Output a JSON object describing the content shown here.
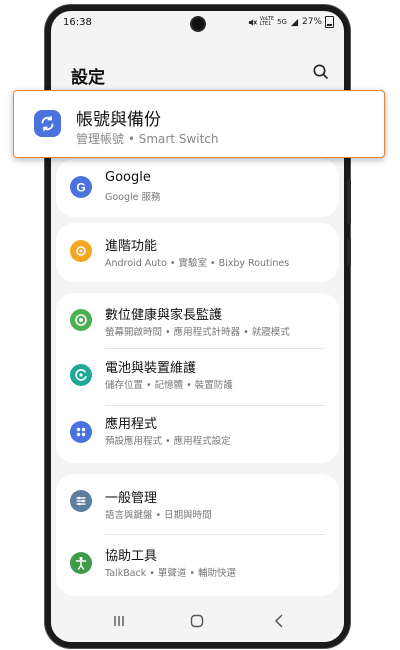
{
  "status_bar": {
    "time": "16:38",
    "net_label_top": "VoLTE",
    "net_label_bottom": "LTE1",
    "net_type": "5G",
    "battery": "27%"
  },
  "header": {
    "title": "設定",
    "search_icon": "search-icon"
  },
  "highlighted_item": {
    "title": "帳號與備份",
    "subtitle": "管理帳號 • Smart Switch",
    "icon": "sync-icon",
    "border_color": "#e8843c"
  },
  "groups": [
    {
      "items": [
        {
          "title": "Google",
          "subtitle": "Google 服務",
          "icon": "google-icon",
          "color": "#4a74dc"
        }
      ]
    },
    {
      "items": [
        {
          "title": "進階功能",
          "subtitle": "Android Auto • 實驗室 • Bixby Routines",
          "icon": "advanced-features-icon",
          "color": "#f5a623"
        }
      ]
    },
    {
      "items": [
        {
          "title": "數位健康與家長監護",
          "subtitle": "螢幕開啟時間 • 應用程式計時器 • 就寢模式",
          "icon": "digital-wellbeing-icon",
          "color": "#4caf50"
        },
        {
          "title": "電池與裝置維護",
          "subtitle": "儲存位置 • 記憶體 • 裝置防護",
          "icon": "device-care-icon",
          "color": "#1fa996"
        },
        {
          "title": "應用程式",
          "subtitle": "預設應用程式 • 應用程式設定",
          "icon": "apps-icon",
          "color": "#4a74dc"
        }
      ]
    },
    {
      "items": [
        {
          "title": "一般管理",
          "subtitle": "語言與鍵盤 • 日期與時間",
          "icon": "general-management-icon",
          "color": "#5c7e9e"
        },
        {
          "title": "協助工具",
          "subtitle": "TalkBack • 單聲道 • 輔助快選",
          "icon": "accessibility-icon",
          "color": "#3f9a4a"
        }
      ]
    }
  ],
  "nav_bar": {
    "recents": "recents-icon",
    "home": "home-icon",
    "back": "back-icon"
  }
}
